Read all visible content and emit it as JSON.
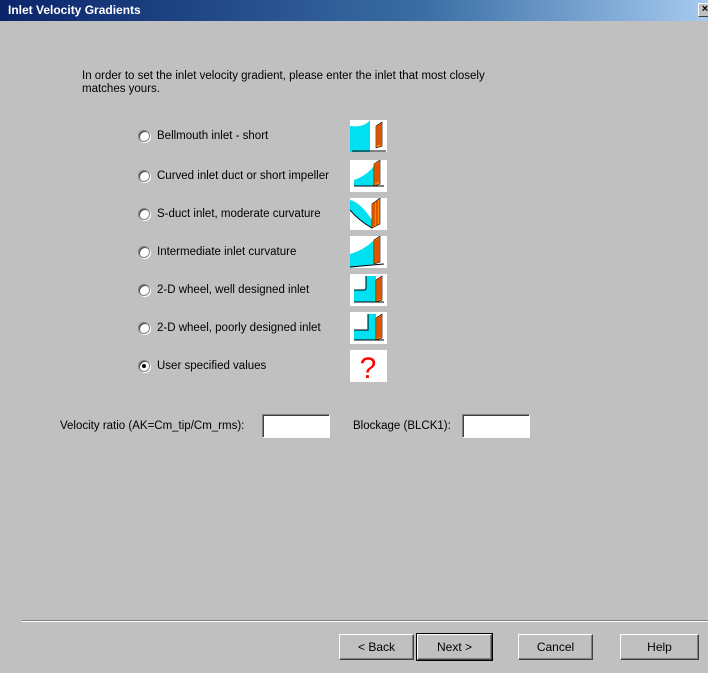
{
  "window": {
    "title": "Inlet Velocity Gradients",
    "close_label": "×"
  },
  "intro_text": "In order to set the inlet velocity gradient, please enter the inlet that most closely matches yours.",
  "options": [
    {
      "label": "Bellmouth inlet - short",
      "checked": false,
      "icon": "bellmouth-short-icon"
    },
    {
      "label": "Curved inlet duct or short impeller",
      "checked": false,
      "icon": "curved-duct-icon"
    },
    {
      "label": "S-duct inlet, moderate curvature",
      "checked": false,
      "icon": "s-duct-icon"
    },
    {
      "label": "Intermediate inlet curvature",
      "checked": false,
      "icon": "intermediate-curvature-icon"
    },
    {
      "label": "2-D wheel, well designed inlet",
      "checked": false,
      "icon": "2d-wheel-good-icon"
    },
    {
      "label": "2-D wheel, poorly designed inlet",
      "checked": false,
      "icon": "2d-wheel-poor-icon"
    },
    {
      "label": "User specified values",
      "checked": true,
      "icon": "question-mark-icon"
    }
  ],
  "fields": {
    "velocity_ratio_label": "Velocity ratio (AK=Cm_tip/Cm_rms):",
    "velocity_ratio_value": "",
    "blockage_label": "Blockage (BLCK1):",
    "blockage_value": ""
  },
  "buttons": {
    "back": "< Back",
    "next": "Next >",
    "cancel": "Cancel",
    "help": "Help"
  },
  "colors": {
    "flow": "#00e0f0",
    "blade": "#ff8800",
    "blade_lines": "#c00000",
    "question": "#ff0000"
  }
}
